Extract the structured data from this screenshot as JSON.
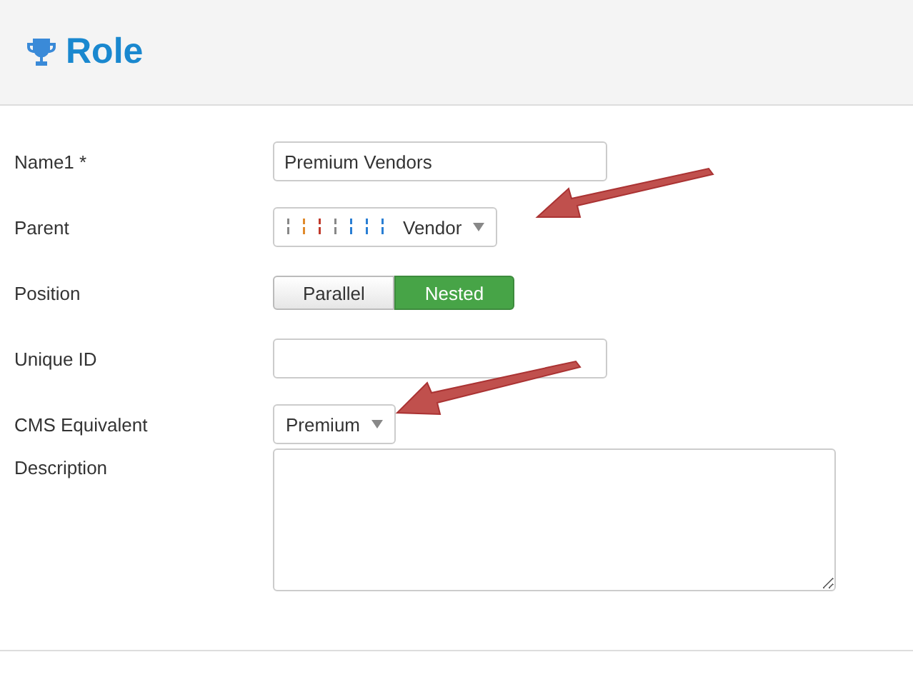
{
  "header": {
    "title": "Role"
  },
  "fields": [
    {
      "kind": "text",
      "label": "Name1 *",
      "value": "Premium Vendors"
    },
    {
      "kind": "select",
      "label": "Parent",
      "value": "Vendor",
      "tree_guides": true
    },
    {
      "kind": "toggle",
      "label": "Position",
      "options": [
        {
          "label": "Parallel",
          "selected": false
        },
        {
          "label": "Nested",
          "selected": true
        }
      ]
    },
    {
      "kind": "text",
      "label": "Unique ID"
    },
    {
      "kind": "select",
      "label": "CMS Equivalent",
      "value": "Premium",
      "tree_guides": false
    },
    {
      "kind": "textarea",
      "label": "Description"
    }
  ]
}
